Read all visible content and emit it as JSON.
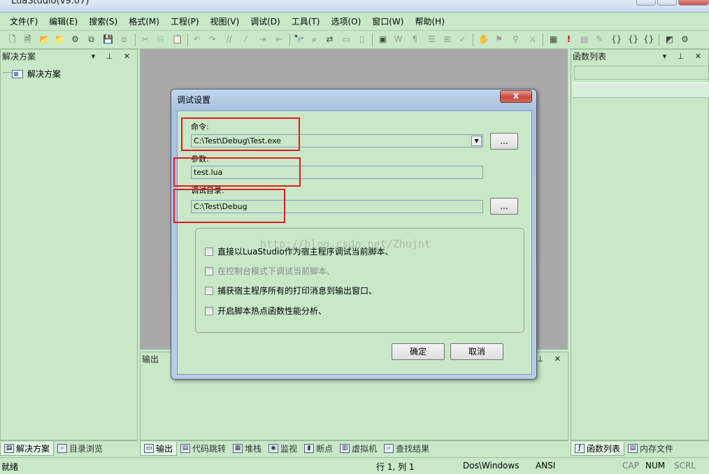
{
  "window": {
    "title": "LuaStudio(v9.07)"
  },
  "menu": [
    "文件(F)",
    "编辑(E)",
    "搜索(S)",
    "格式(M)",
    "工程(P)",
    "视图(V)",
    "调试(D)",
    "工具(T)",
    "选项(O)",
    "窗口(W)",
    "帮助(H)"
  ],
  "left_panel": {
    "title": "解决方案",
    "controls": "▾ ⊥ ✕",
    "tree_root": "解决方案"
  },
  "right_panel": {
    "title": "函数列表",
    "controls": "▾ ⊥ ✕"
  },
  "output_panel": {
    "title": "输出",
    "controls": "▾ ⊥ ✕"
  },
  "dialog": {
    "title": "调试设置",
    "close": "x",
    "command_label": "命令:",
    "command_value": "C:\\Test\\Debug\\Test.exe",
    "browse": "...",
    "args_label": "参数:",
    "args_value": "test.lua",
    "dir_label": "调试目录:",
    "dir_value": "C:\\Test\\Debug",
    "options": [
      {
        "label": "直接以LuaStudio作为宿主程序调试当前脚本、",
        "enabled": true
      },
      {
        "label": "在控制台模式下调试当前脚本、",
        "enabled": false
      },
      {
        "label": "捕获宿主程序所有的打印消息到输出窗口、",
        "enabled": true
      },
      {
        "label": "开启脚本热点函数性能分析、",
        "enabled": true
      }
    ],
    "ok": "确定",
    "cancel": "取消"
  },
  "watermark": "http://blog.csdn.net/Zhujnt",
  "left_tabs": [
    "解决方案",
    "目录浏览"
  ],
  "bottom_tabs": [
    "输出",
    "代码跳转",
    "堆栈",
    "监视",
    "断点",
    "虚拟机",
    "查找结果"
  ],
  "right_tabs": [
    "函数列表",
    "内存文件"
  ],
  "status": {
    "ready": "就绪",
    "position": "行 1, 列 1",
    "line_ending": "Dos\\Windows",
    "encoding": "ANSI",
    "cap": "CAP",
    "num": "NUM",
    "scrl": "SCRL"
  }
}
